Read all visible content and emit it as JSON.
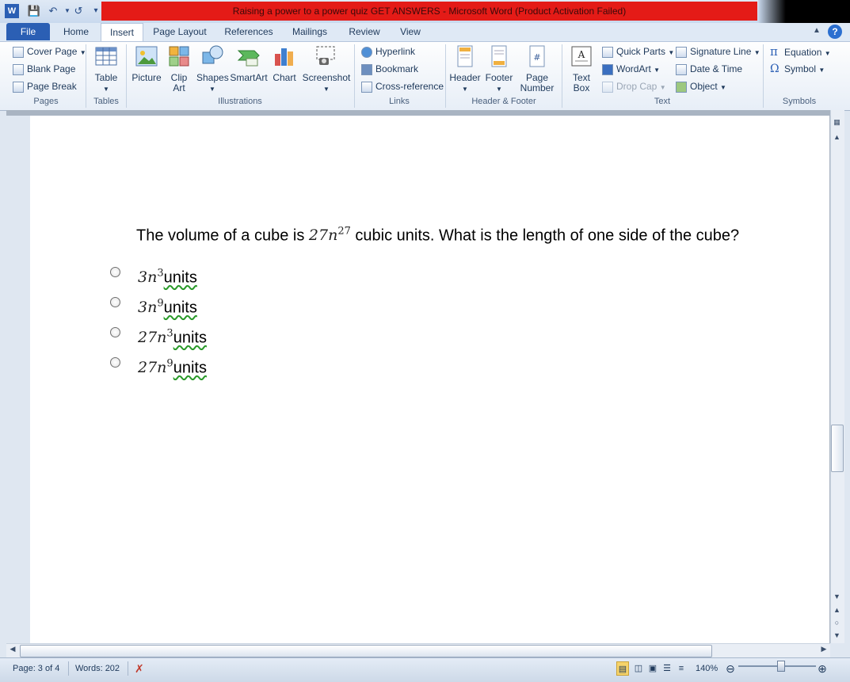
{
  "window": {
    "title": "Raising a power to a power quiz GET ANSWERS  -  Microsoft Word (Product Activation Failed)"
  },
  "tabs": [
    {
      "label": "File"
    },
    {
      "label": "Home"
    },
    {
      "label": "Insert"
    },
    {
      "label": "Page Layout"
    },
    {
      "label": "References"
    },
    {
      "label": "Mailings"
    },
    {
      "label": "Review"
    },
    {
      "label": "View"
    }
  ],
  "ribbon": {
    "pages": {
      "label": "Pages",
      "items": [
        "Cover Page",
        "Blank Page",
        "Page Break"
      ]
    },
    "tables": {
      "label": "Tables",
      "table": "Table"
    },
    "illustrations": {
      "label": "Illustrations",
      "picture": "Picture",
      "clip_art": "Clip Art",
      "shapes": "Shapes",
      "smartart": "SmartArt",
      "chart": "Chart",
      "screenshot": "Screenshot"
    },
    "links": {
      "label": "Links",
      "items": [
        "Hyperlink",
        "Bookmark",
        "Cross-reference"
      ]
    },
    "header_footer": {
      "label": "Header & Footer",
      "header": "Header",
      "footer": "Footer",
      "page_number": "Page Number"
    },
    "text": {
      "label": "Text",
      "text_box": "Text Box",
      "quick_parts": "Quick Parts",
      "wordart": "WordArt",
      "drop_cap": "Drop Cap",
      "signature_line": "Signature Line",
      "date_time": "Date & Time",
      "object": "Object"
    },
    "symbols": {
      "label": "Symbols",
      "equation": "Equation",
      "symbol": "Symbol"
    }
  },
  "document": {
    "question_pre": "The volume of a cube is ",
    "question_math_base": "27n",
    "question_math_exp": "27",
    "question_post": " cubic units. What is the length of one side of the cube?",
    "options": [
      {
        "base": "3n",
        "exp": "3",
        "unit": "units"
      },
      {
        "base": "3n",
        "exp": "9",
        "unit": "units"
      },
      {
        "base": "27n",
        "exp": "3",
        "unit": "units"
      },
      {
        "base": "27n",
        "exp": "9",
        "unit": "units"
      }
    ]
  },
  "status": {
    "page": "Page: 3 of 4",
    "words": "Words: 202",
    "zoom": "140%"
  },
  "colors": {
    "title_bar_alert": "#e41b17",
    "file_tab": "#2b5fb4"
  }
}
